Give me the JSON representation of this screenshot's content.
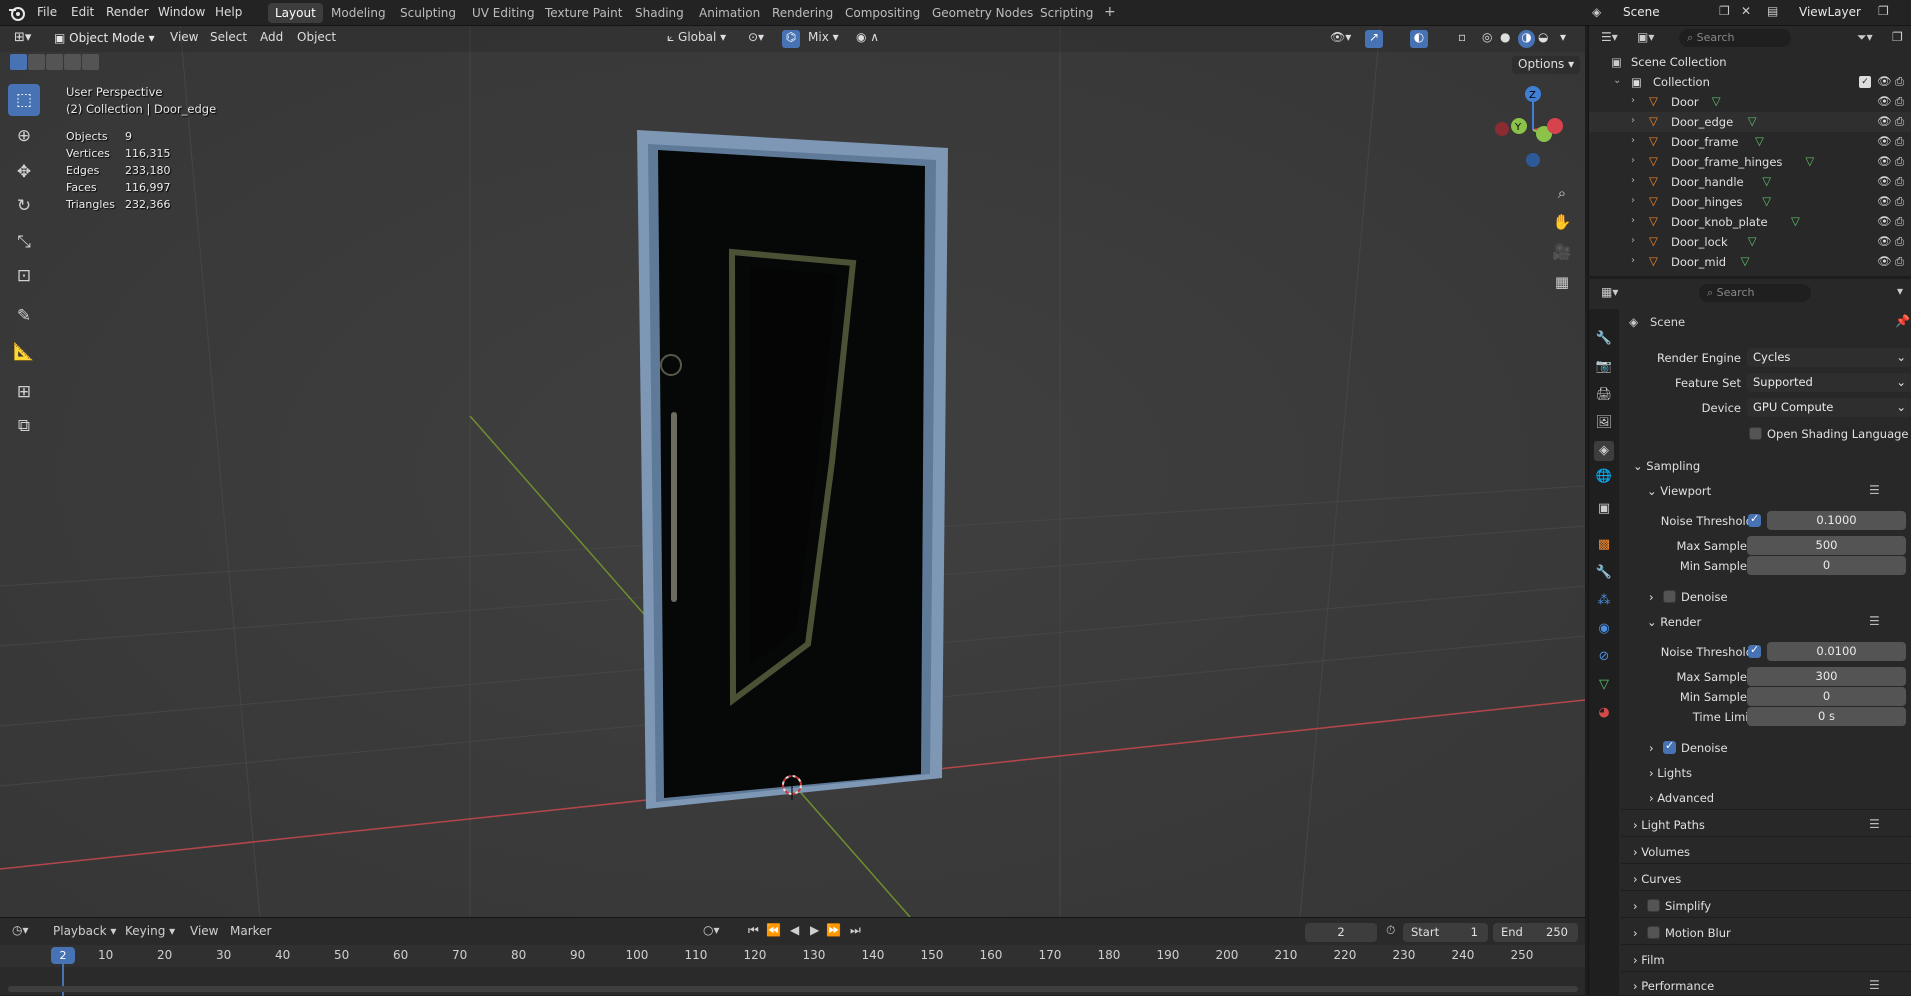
{
  "menu": [
    "File",
    "Edit",
    "Render",
    "Window",
    "Help"
  ],
  "workspaces": [
    "Layout",
    "Modeling",
    "Sculpting",
    "UV Editing",
    "Texture Paint",
    "Shading",
    "Animation",
    "Rendering",
    "Compositing",
    "Geometry Nodes",
    "Scripting"
  ],
  "add_workspace": "+",
  "scene_name": "Scene",
  "view_layer": "ViewLayer",
  "viewport_header": {
    "mode": "Object Mode",
    "view": "View",
    "select": "Select",
    "add": "Add",
    "object": "Object",
    "transform_orientation": "Global",
    "snap_mode": "Mix",
    "options": "Options"
  },
  "overlay": {
    "perspective": "User Perspective",
    "context": "(2) Collection | Door_edge",
    "stats": [
      {
        "label": "Objects",
        "value": "9"
      },
      {
        "label": "Vertices",
        "value": "116,315"
      },
      {
        "label": "Edges",
        "value": "233,180"
      },
      {
        "label": "Faces",
        "value": "116,997"
      },
      {
        "label": "Triangles",
        "value": "232,366"
      }
    ]
  },
  "gizmo": {
    "z": "Z",
    "y": "Y"
  },
  "outliner": {
    "search_placeholder": "Search",
    "scene_collection": "Scene Collection",
    "collection": "Collection",
    "objects": [
      "Door",
      "Door_edge",
      "Door_frame",
      "Door_frame_hinges",
      "Door_handle",
      "Door_hinges",
      "Door_knob_plate",
      "Door_lock",
      "Door_mid"
    ]
  },
  "properties": {
    "search_placeholder": "Search",
    "context": "Scene",
    "render_engine_label": "Render Engine",
    "render_engine": "Cycles",
    "feature_set_label": "Feature Set",
    "feature_set": "Supported",
    "device_label": "Device",
    "device": "GPU Compute",
    "osl_label": "Open Shading Language",
    "sampling": "Sampling",
    "viewport": "Viewport",
    "vp_noise_threshold_label": "Noise Threshold",
    "vp_noise_threshold": "0.1000",
    "vp_max_samples_label": "Max Samples",
    "vp_max_samples": "500",
    "vp_min_samples_label": "Min Samples",
    "vp_min_samples": "0",
    "vp_denoise": "Denoise",
    "render": "Render",
    "r_noise_threshold_label": "Noise Threshold",
    "r_noise_threshold": "0.0100",
    "r_max_samples_label": "Max Samples",
    "r_max_samples": "300",
    "r_min_samples_label": "Min Samples",
    "r_min_samples": "0",
    "r_time_limit_label": "Time Limit",
    "r_time_limit": "0 s",
    "r_denoise": "Denoise",
    "lights": "Lights",
    "advanced": "Advanced",
    "light_paths": "Light Paths",
    "volumes": "Volumes",
    "curves": "Curves",
    "simplify": "Simplify",
    "motion_blur": "Motion Blur",
    "film": "Film",
    "performance": "Performance"
  },
  "timeline": {
    "playback": "Playback",
    "keying": "Keying",
    "view": "View",
    "marker": "Marker",
    "current_frame": "2",
    "start_label": "Start",
    "start": "1",
    "end_label": "End",
    "end": "250",
    "ruler": [
      "10",
      "20",
      "30",
      "40",
      "50",
      "60",
      "70",
      "80",
      "90",
      "100",
      "110",
      "120",
      "130",
      "140",
      "150",
      "160",
      "170",
      "180",
      "190",
      "200",
      "210",
      "220",
      "230",
      "240",
      "250"
    ],
    "playhead": "2"
  },
  "colors": {
    "accent": "#4772b3",
    "x_axis": "#d6434d",
    "y_axis": "#8bc34a",
    "z_axis": "#3f7fd6",
    "frame": "#7d97b5"
  }
}
